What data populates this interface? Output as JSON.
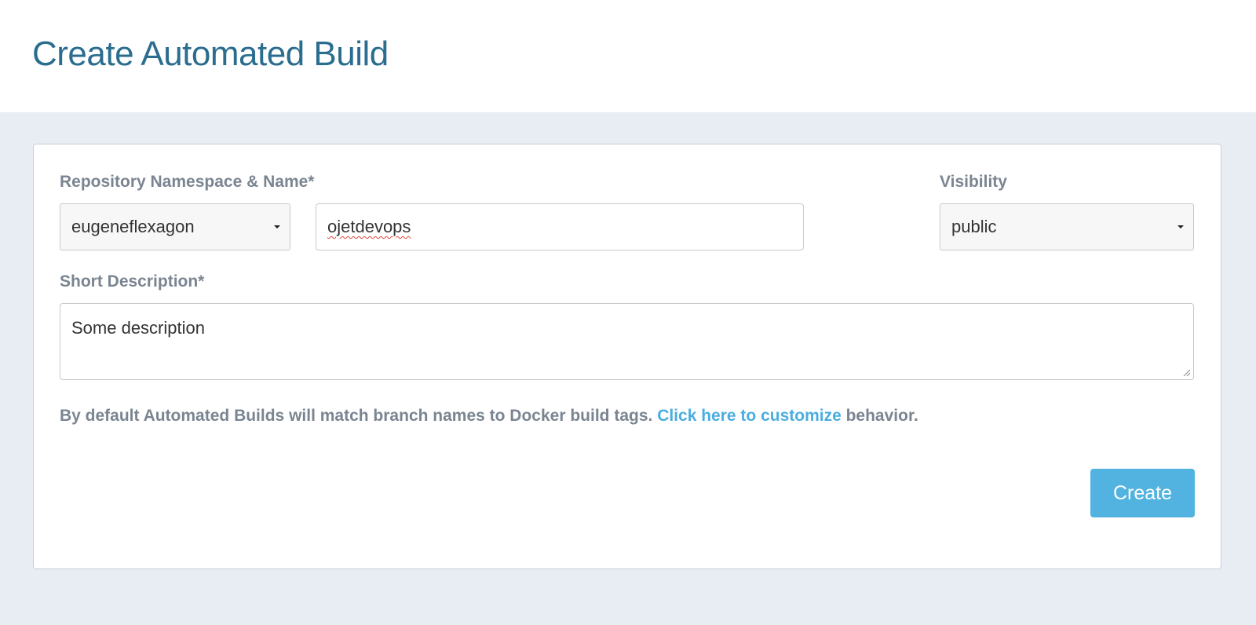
{
  "header": {
    "title": "Create Automated Build"
  },
  "form": {
    "repo_label": "Repository Namespace & Name*",
    "namespace": {
      "selected": "eugeneflexagon"
    },
    "repo_name": {
      "value": "ojetdevops"
    },
    "visibility_label": "Visibility",
    "visibility": {
      "selected": "public"
    },
    "description_label": "Short Description*",
    "description": {
      "value": "Some description"
    },
    "help": {
      "prefix": "By default Automated Builds will match branch names to Docker build tags. ",
      "link": "Click here to customize",
      "suffix": " behavior."
    },
    "create_label": "Create"
  },
  "colors": {
    "title": "#2b6d8f",
    "link": "#4aaee0",
    "button": "#52b3e0",
    "background": "#e8edf4"
  },
  "icons": [
    "caret-down-icon",
    "resize-grip-icon"
  ]
}
